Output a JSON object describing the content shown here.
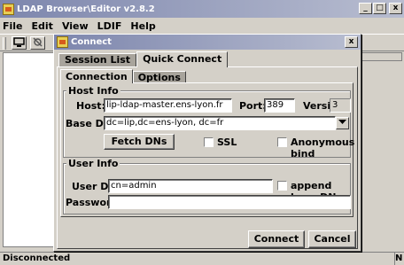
{
  "main_window": {
    "title": "LDAP Browser\\Editor v2.8.2",
    "min_label": "_",
    "max_label": "□",
    "close_label": "x"
  },
  "menu": {
    "file": "File",
    "edit": "Edit",
    "view": "View",
    "ldif": "LDIF",
    "help": "Help"
  },
  "status": {
    "text": "Disconnected",
    "right": "N"
  },
  "dialog": {
    "title": "Connect",
    "close_label": "x",
    "tabs": [
      "Session List",
      "Quick Connect"
    ],
    "subtabs": [
      "Connection",
      "Options"
    ],
    "host_info": {
      "title": "Host Info",
      "host_label": "Host:",
      "host_value": "lip-ldap-master.ens-lyon.fr",
      "port_label": "Port:",
      "port_value": "389",
      "version_label": "Version:",
      "version_value": "3",
      "base_dn_label": "Base DN:",
      "base_dn_value": "dc=lip,dc=ens-lyon, dc=fr",
      "fetch_label": "Fetch DNs",
      "ssl_label": "SSL",
      "anon_label": "Anonymous bind"
    },
    "user_info": {
      "title": "User Info",
      "user_dn_label": "User DN:",
      "user_dn_value": "cn=admin",
      "append_label": "append base DN",
      "password_label": "Password:",
      "password_value": ""
    },
    "connect_label": "Connect",
    "cancel_label": "Cancel"
  }
}
